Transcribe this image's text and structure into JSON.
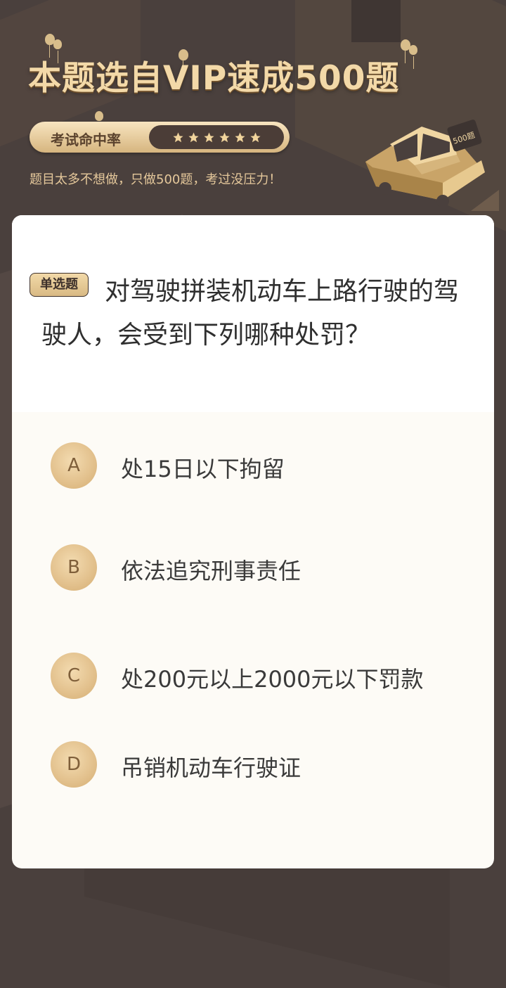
{
  "header": {
    "title": "本题选自VIP速成500题",
    "rate_label": "考试命中率",
    "star_count": 6,
    "subtitle": "题目太多不想做，只做500题，考过没压力！",
    "car_badge": "500题"
  },
  "question": {
    "type_badge": "单选题",
    "text": "对驾驶拼装机动车上路行驶的驾驶人，会受到下列哪种处罚？"
  },
  "options": [
    {
      "letter": "A",
      "text": "处15日以下拘留"
    },
    {
      "letter": "B",
      "text": "依法追究刑事责任"
    },
    {
      "letter": "C",
      "text": "处200元以上2000元以下罚款"
    },
    {
      "letter": "D",
      "text": "吊销机动车行驶证"
    }
  ],
  "colors": {
    "background": "#4a403d",
    "gold": "#f3d9a8",
    "card": "#fdfbf6"
  }
}
